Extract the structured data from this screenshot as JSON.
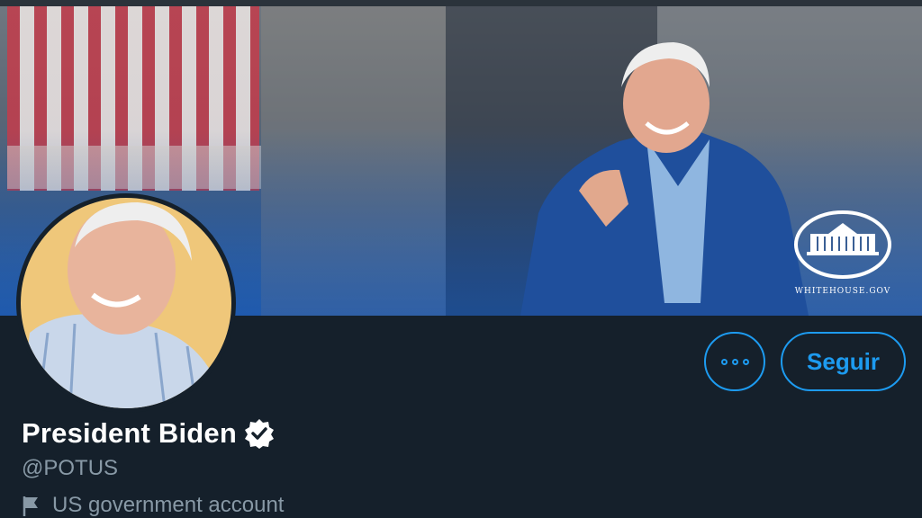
{
  "banner": {
    "logo_caption": "WHITEHOUSE.GOV",
    "logo_icon": "white-house-icon"
  },
  "profile": {
    "name": "President Biden",
    "verified_icon": "verified-badge-icon",
    "handle": "@POTUS",
    "account_label": "US government account",
    "account_icon": "flag-icon"
  },
  "actions": {
    "more_icon": "more-options-icon",
    "follow_label": "Seguir"
  },
  "colors": {
    "background": "#15202b",
    "accent": "#1d9bf0",
    "secondary_text": "#8899a6"
  }
}
